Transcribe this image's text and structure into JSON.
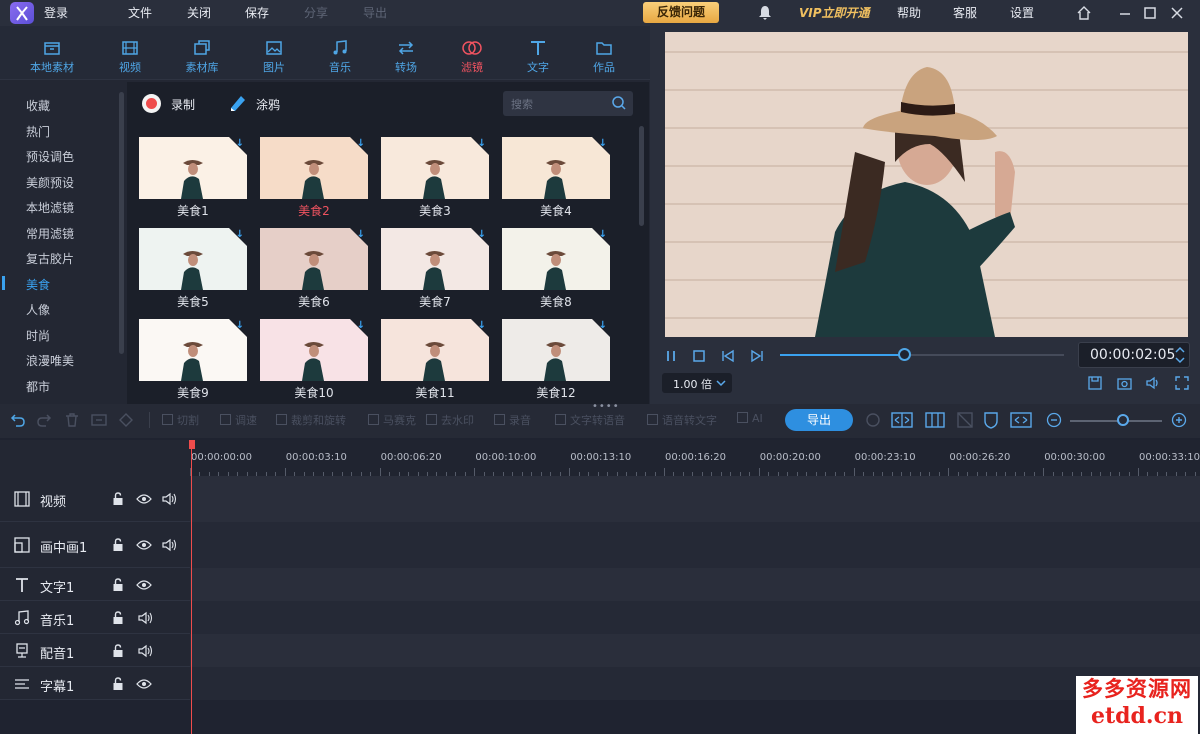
{
  "titlebar": {
    "login": "登录",
    "menu": [
      "文件",
      "关闭",
      "保存",
      "分享",
      "导出"
    ],
    "feedback": "反馈问题",
    "vip": "VIP立即开通",
    "right_menu": [
      "帮助",
      "客服",
      "设置"
    ]
  },
  "categories": [
    {
      "label": "本地素材",
      "icon": "box-icon"
    },
    {
      "label": "视频",
      "icon": "film-icon"
    },
    {
      "label": "素材库",
      "icon": "library-icon"
    },
    {
      "label": "图片",
      "icon": "image-icon"
    },
    {
      "label": "音乐",
      "icon": "music-icon"
    },
    {
      "label": "转场",
      "icon": "transition-icon"
    },
    {
      "label": "滤镜",
      "icon": "filter-icon",
      "active": true
    },
    {
      "label": "文字",
      "icon": "text-icon"
    },
    {
      "label": "作品",
      "icon": "folder-icon"
    }
  ],
  "sidebar": {
    "items": [
      "收藏",
      "热门",
      "预设调色",
      "美颜预设",
      "本地滤镜",
      "常用滤镜",
      "复古胶片",
      "美食",
      "人像",
      "时尚",
      "浪漫唯美",
      "都市"
    ],
    "active_index": 7
  },
  "panel": {
    "record": "录制",
    "doodle": "涂鸦",
    "search_placeholder": "搜索",
    "filters": [
      {
        "label": "美食1",
        "tint": "#fbf1e6"
      },
      {
        "label": "美食2",
        "tint": "#f6dcc8",
        "selected": true
      },
      {
        "label": "美食3",
        "tint": "#f8e9dc"
      },
      {
        "label": "美食4",
        "tint": "#f7e7d6"
      },
      {
        "label": "美食5",
        "tint": "#eef3f1"
      },
      {
        "label": "美食6",
        "tint": "#e6cfc8"
      },
      {
        "label": "美食7",
        "tint": "#f3e8e4"
      },
      {
        "label": "美食8",
        "tint": "#f3f2ea"
      },
      {
        "label": "美食9",
        "tint": "#fbf8f4"
      },
      {
        "label": "美食10",
        "tint": "#f8e2e6"
      },
      {
        "label": "美食11",
        "tint": "#f6e4dc"
      },
      {
        "label": "美食12",
        "tint": "#eeebe8"
      }
    ]
  },
  "preview": {
    "time": "00:00:02:05",
    "speed": "1.00 倍",
    "progress": 0.44
  },
  "toolbar": {
    "tools": [
      "切割",
      "调速",
      "裁剪和旋转",
      "马赛克",
      "去水印",
      "录音",
      "文字转语音",
      "语音转文字",
      "AI"
    ],
    "export": "导出"
  },
  "timeline": {
    "ticks": [
      "00:00:00:00",
      "00:00:03:10",
      "00:00:06:20",
      "00:00:10:00",
      "00:00:13:10",
      "00:00:16:20",
      "00:00:20:00",
      "00:00:23:10",
      "00:00:26:20",
      "00:00:30:00",
      "00:00:33:10"
    ],
    "tracks": [
      {
        "name": "视频",
        "icon": "film-icon",
        "lock": true,
        "eye": true,
        "sound": true
      },
      {
        "name": "画中画1",
        "icon": "pip-icon",
        "lock": true,
        "eye": true,
        "sound": true
      },
      {
        "name": "文字1",
        "icon": "text-icon",
        "lock": true,
        "eye": true,
        "sound": false
      },
      {
        "name": "音乐1",
        "icon": "music-icon",
        "lock": true,
        "eye": false,
        "sound": true
      },
      {
        "name": "配音1",
        "icon": "mic-icon",
        "lock": true,
        "eye": false,
        "sound": true
      },
      {
        "name": "字幕1",
        "icon": "subtitle-icon",
        "lock": true,
        "eye": true,
        "sound": false
      }
    ]
  },
  "watermark": {
    "line1": "多多资源网",
    "line2": "etdd.cn"
  }
}
